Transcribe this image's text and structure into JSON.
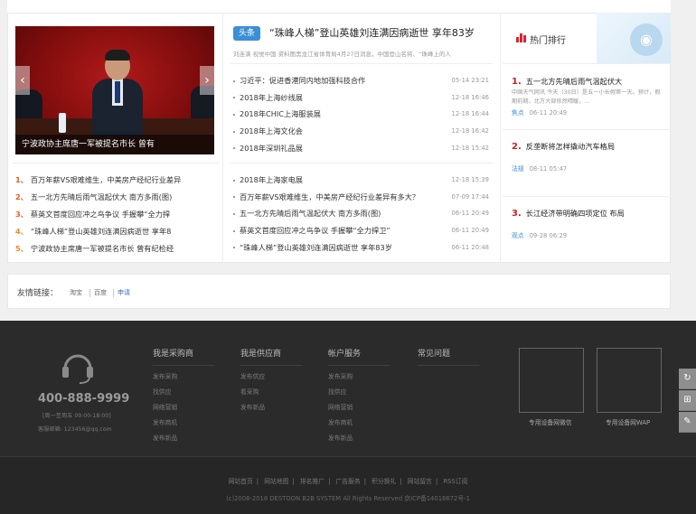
{
  "slider": {
    "caption": "宁波政协主席唐一军被提名市长 曾有",
    "prev": "‹",
    "next": "›"
  },
  "left_list": [
    {
      "num": "1、",
      "text": "百万年薪VS艰难维生，中美房产经纪行业差异"
    },
    {
      "num": "2、",
      "text": "五一北方先晴后雨气温起伏大 南方多雨(图)"
    },
    {
      "num": "3、",
      "text": "蔡英文首度回应冲之鸟争议 手握攀“全力捍"
    },
    {
      "num": "4、",
      "text": "“珠峰人梯”登山英雄刘连满因病逝世 享年8"
    },
    {
      "num": "5、",
      "text": "宁波政协主席唐一军被提名市长 曾有纪检经"
    }
  ],
  "headline": {
    "badge": "头条",
    "title": "“珠峰人梯”登山英雄刘连满因病逝世 享年83岁",
    "summary": "刘连满 视觉中国 资料图黑龙江省体育局4月27日消息，中国登山名将、“珠峰上的人"
  },
  "mid_list_1": [
    {
      "text": "习近平：促进香港同内地加强科技合作",
      "date": "05-14 23:21"
    },
    {
      "text": "2018年上海纱线展",
      "date": "12-18 16:46"
    },
    {
      "text": "2018年CHIC上海服装展",
      "date": "12-18 16:44"
    },
    {
      "text": "2018年上海文化会",
      "date": "12-18 16:42"
    },
    {
      "text": "2018年深圳礼品展",
      "date": "12-18 15:42"
    }
  ],
  "mid_list_2": [
    {
      "text": "2018年上海家电展",
      "date": "12-18 15:39"
    },
    {
      "text": "百万年薪VS艰难维生，中美房产经纪行业差异有多大？",
      "date": "07-09 17:44"
    },
    {
      "text": "五一北方先晴后雨气温起伏大 南方多雨(图)",
      "date": "06-11 20:49"
    },
    {
      "text": "蔡英文首度回应冲之鸟争议 手握攀“全力捍卫”",
      "date": "06-11 20:49"
    },
    {
      "text": "“珠峰人梯”登山英雄刘连满因病逝世 享年83岁",
      "date": "06-11 20:48"
    }
  ],
  "hot": {
    "title": "热门排行",
    "items": [
      {
        "num": "1.",
        "title": "五一北方先晴后雨气温起伏大",
        "desc": "中国天气网讯 今天（30日）是五一小长假第一天。预计，假期前期，北方大部依然晴暖，…",
        "tag": "焦点",
        "date": "06-11 20:49"
      },
      {
        "num": "2.",
        "title": "反垄断将怎样撬动汽车格局",
        "desc": "",
        "tag": "法规",
        "date": "08-11 05:47"
      },
      {
        "num": "3.",
        "title": "长江经济带明确四项定位 布局",
        "desc": "",
        "tag": "观点",
        "date": "09-28 06:29"
      }
    ]
  },
  "friend_links": {
    "label": "友情链接：",
    "items": [
      "淘宝",
      "百度",
      "申请"
    ]
  },
  "footer": {
    "phone": "400-888-9999",
    "hours": "[周一至周五 09:00-18:00]",
    "email": "客服邮箱: 123456@qq.com",
    "columns": [
      {
        "title": "我是采购商",
        "links": [
          "发布采购",
          "找供应",
          "网络营销",
          "发布商机",
          "发布新品"
        ]
      },
      {
        "title": "我是供应商",
        "links": [
          "发布供应",
          "看采购",
          "发布新品"
        ]
      },
      {
        "title": "帐户服务",
        "links": [
          "发布采购",
          "找供应",
          "网络营销",
          "发布商机",
          "发布新品"
        ]
      },
      {
        "title": "常见问题",
        "links": []
      }
    ],
    "qr": [
      {
        "label": "专用设备网微信"
      },
      {
        "label": "专用设备网WAP"
      }
    ],
    "bottom_links": [
      "网站首页",
      "网站地图",
      "排名推广",
      "广告服务",
      "积分换礼",
      "网站留言",
      "RSS订阅"
    ],
    "copyright": "(c)2008-2018 DESTOON B2B SYSTEM All Rights Reserved  京ICP备14018672号-1"
  },
  "side_tools": [
    "↻",
    "⊞",
    "✎"
  ]
}
